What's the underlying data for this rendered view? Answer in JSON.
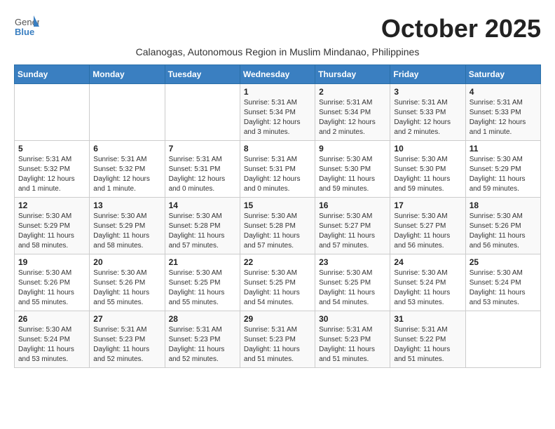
{
  "header": {
    "logo_general": "General",
    "logo_blue": "Blue",
    "month_title": "October 2025",
    "subtitle": "Calanogas, Autonomous Region in Muslim Mindanao, Philippines"
  },
  "days_of_week": [
    "Sunday",
    "Monday",
    "Tuesday",
    "Wednesday",
    "Thursday",
    "Friday",
    "Saturday"
  ],
  "weeks": [
    [
      {
        "day": "",
        "info": ""
      },
      {
        "day": "",
        "info": ""
      },
      {
        "day": "",
        "info": ""
      },
      {
        "day": "1",
        "info": "Sunrise: 5:31 AM\nSunset: 5:34 PM\nDaylight: 12 hours and 3 minutes."
      },
      {
        "day": "2",
        "info": "Sunrise: 5:31 AM\nSunset: 5:34 PM\nDaylight: 12 hours and 2 minutes."
      },
      {
        "day": "3",
        "info": "Sunrise: 5:31 AM\nSunset: 5:33 PM\nDaylight: 12 hours and 2 minutes."
      },
      {
        "day": "4",
        "info": "Sunrise: 5:31 AM\nSunset: 5:33 PM\nDaylight: 12 hours and 1 minute."
      }
    ],
    [
      {
        "day": "5",
        "info": "Sunrise: 5:31 AM\nSunset: 5:32 PM\nDaylight: 12 hours and 1 minute."
      },
      {
        "day": "6",
        "info": "Sunrise: 5:31 AM\nSunset: 5:32 PM\nDaylight: 12 hours and 1 minute."
      },
      {
        "day": "7",
        "info": "Sunrise: 5:31 AM\nSunset: 5:31 PM\nDaylight: 12 hours and 0 minutes."
      },
      {
        "day": "8",
        "info": "Sunrise: 5:31 AM\nSunset: 5:31 PM\nDaylight: 12 hours and 0 minutes."
      },
      {
        "day": "9",
        "info": "Sunrise: 5:30 AM\nSunset: 5:30 PM\nDaylight: 11 hours and 59 minutes."
      },
      {
        "day": "10",
        "info": "Sunrise: 5:30 AM\nSunset: 5:30 PM\nDaylight: 11 hours and 59 minutes."
      },
      {
        "day": "11",
        "info": "Sunrise: 5:30 AM\nSunset: 5:29 PM\nDaylight: 11 hours and 59 minutes."
      }
    ],
    [
      {
        "day": "12",
        "info": "Sunrise: 5:30 AM\nSunset: 5:29 PM\nDaylight: 11 hours and 58 minutes."
      },
      {
        "day": "13",
        "info": "Sunrise: 5:30 AM\nSunset: 5:29 PM\nDaylight: 11 hours and 58 minutes."
      },
      {
        "day": "14",
        "info": "Sunrise: 5:30 AM\nSunset: 5:28 PM\nDaylight: 11 hours and 57 minutes."
      },
      {
        "day": "15",
        "info": "Sunrise: 5:30 AM\nSunset: 5:28 PM\nDaylight: 11 hours and 57 minutes."
      },
      {
        "day": "16",
        "info": "Sunrise: 5:30 AM\nSunset: 5:27 PM\nDaylight: 11 hours and 57 minutes."
      },
      {
        "day": "17",
        "info": "Sunrise: 5:30 AM\nSunset: 5:27 PM\nDaylight: 11 hours and 56 minutes."
      },
      {
        "day": "18",
        "info": "Sunrise: 5:30 AM\nSunset: 5:26 PM\nDaylight: 11 hours and 56 minutes."
      }
    ],
    [
      {
        "day": "19",
        "info": "Sunrise: 5:30 AM\nSunset: 5:26 PM\nDaylight: 11 hours and 55 minutes."
      },
      {
        "day": "20",
        "info": "Sunrise: 5:30 AM\nSunset: 5:26 PM\nDaylight: 11 hours and 55 minutes."
      },
      {
        "day": "21",
        "info": "Sunrise: 5:30 AM\nSunset: 5:25 PM\nDaylight: 11 hours and 55 minutes."
      },
      {
        "day": "22",
        "info": "Sunrise: 5:30 AM\nSunset: 5:25 PM\nDaylight: 11 hours and 54 minutes."
      },
      {
        "day": "23",
        "info": "Sunrise: 5:30 AM\nSunset: 5:25 PM\nDaylight: 11 hours and 54 minutes."
      },
      {
        "day": "24",
        "info": "Sunrise: 5:30 AM\nSunset: 5:24 PM\nDaylight: 11 hours and 53 minutes."
      },
      {
        "day": "25",
        "info": "Sunrise: 5:30 AM\nSunset: 5:24 PM\nDaylight: 11 hours and 53 minutes."
      }
    ],
    [
      {
        "day": "26",
        "info": "Sunrise: 5:30 AM\nSunset: 5:24 PM\nDaylight: 11 hours and 53 minutes."
      },
      {
        "day": "27",
        "info": "Sunrise: 5:31 AM\nSunset: 5:23 PM\nDaylight: 11 hours and 52 minutes."
      },
      {
        "day": "28",
        "info": "Sunrise: 5:31 AM\nSunset: 5:23 PM\nDaylight: 11 hours and 52 minutes."
      },
      {
        "day": "29",
        "info": "Sunrise: 5:31 AM\nSunset: 5:23 PM\nDaylight: 11 hours and 51 minutes."
      },
      {
        "day": "30",
        "info": "Sunrise: 5:31 AM\nSunset: 5:23 PM\nDaylight: 11 hours and 51 minutes."
      },
      {
        "day": "31",
        "info": "Sunrise: 5:31 AM\nSunset: 5:22 PM\nDaylight: 11 hours and 51 minutes."
      },
      {
        "day": "",
        "info": ""
      }
    ]
  ]
}
